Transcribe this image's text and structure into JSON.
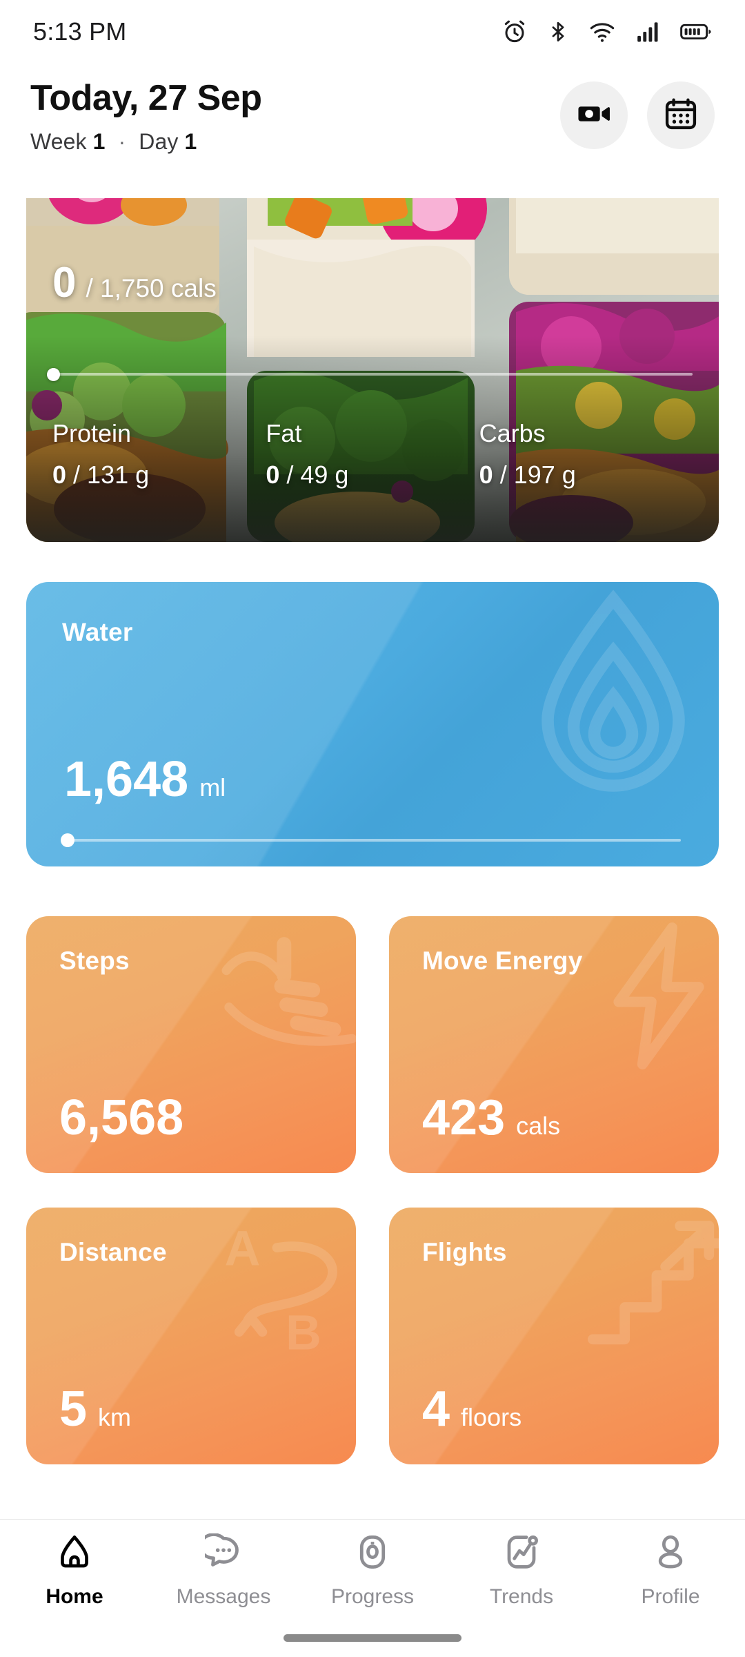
{
  "statusbar": {
    "time": "5:13 PM",
    "icons": [
      "alarm-icon",
      "bluetooth-icon",
      "wifi-icon",
      "cellular-signal-icon",
      "battery-icon"
    ]
  },
  "header": {
    "title": "Today, 27 Sep",
    "week_label": "Week",
    "week_value": "1",
    "separator": "·",
    "day_label": "Day",
    "day_value": "1",
    "actions": [
      {
        "name": "video-camera-icon",
        "label": "Video"
      },
      {
        "name": "calendar-icon",
        "label": "Calendar"
      }
    ]
  },
  "nutrition": {
    "consumed": "0",
    "goal_text": "/ 1,750 cals",
    "progress_percent": 0,
    "macros": [
      {
        "label": "Protein",
        "consumed": "0",
        "goal": "/ 131 g"
      },
      {
        "label": "Fat",
        "consumed": "0",
        "goal": "/ 49 g"
      },
      {
        "label": "Carbs",
        "consumed": "0",
        "goal": "/ 197 g"
      }
    ]
  },
  "water": {
    "label": "Water",
    "value": "1,648",
    "unit": "ml",
    "progress_percent": 0,
    "color": "#4CABDF",
    "watermark": "water-drop-icon"
  },
  "tiles": [
    {
      "label": "Steps",
      "value": "6,568",
      "unit": "",
      "watermark": "running-shoe-icon"
    },
    {
      "label": "Move Energy",
      "value": "423",
      "unit": "cals",
      "watermark": "lightning-bolt-icon"
    },
    {
      "label": "Distance",
      "value": "5",
      "unit": "km",
      "watermark": "route-a-to-b-icon"
    },
    {
      "label": "Flights",
      "value": "4",
      "unit": "floors",
      "watermark": "stairs-arrow-icon"
    }
  ],
  "colors": {
    "orange_top": "#EFA45E",
    "orange_bottom": "#F78A50",
    "water_blue": "#4CABDF",
    "nav_inactive": "#8E8E93",
    "nav_active": "#000000"
  },
  "bottomnav": {
    "items": [
      {
        "label": "Home",
        "icon": "home-icon",
        "active": true
      },
      {
        "label": "Messages",
        "icon": "chat-bubble-icon",
        "active": false
      },
      {
        "label": "Progress",
        "icon": "scale-icon",
        "active": false
      },
      {
        "label": "Trends",
        "icon": "trend-chart-icon",
        "active": false
      },
      {
        "label": "Profile",
        "icon": "person-icon",
        "active": false
      }
    ]
  }
}
